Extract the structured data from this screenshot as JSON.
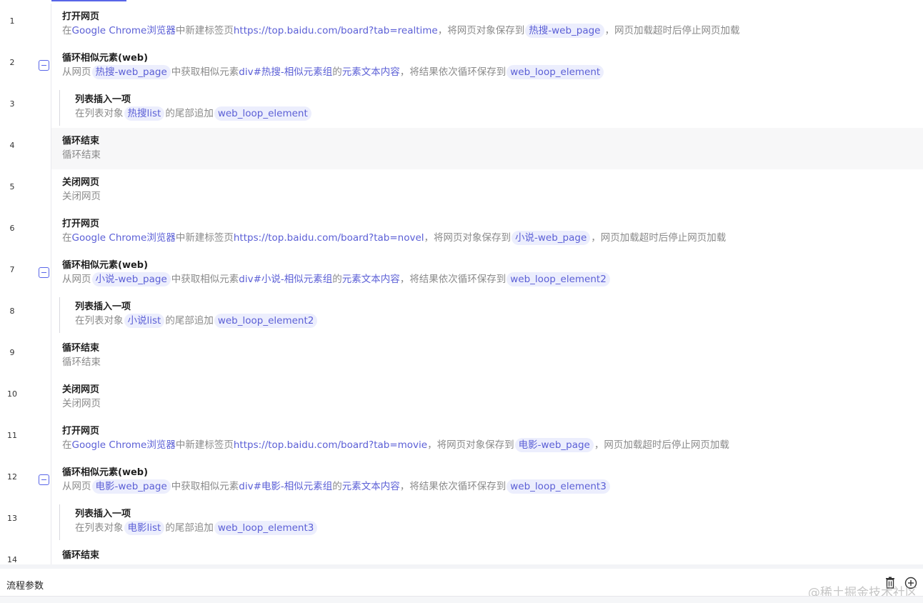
{
  "steps": [
    {
      "no": "1",
      "title": "打开网页",
      "level": 0,
      "collapsible": false,
      "highlight": false,
      "desc": [
        {
          "t": "text",
          "v": "在"
        },
        {
          "t": "link",
          "v": "Google Chrome浏览器"
        },
        {
          "t": "text",
          "v": "中新建标签页"
        },
        {
          "t": "link",
          "v": "https://top.baidu.com/board?tab=realtime"
        },
        {
          "t": "text",
          "v": "，将网页对象保存到"
        },
        {
          "t": "chip",
          "v": "热搜-web_page"
        },
        {
          "t": "text",
          "v": "，网页加载超时后停止网页加载"
        }
      ]
    },
    {
      "no": "2",
      "title": "循环相似元素(web)",
      "level": 0,
      "collapsible": true,
      "highlight": false,
      "desc": [
        {
          "t": "text",
          "v": "从网页"
        },
        {
          "t": "chip",
          "v": "热搜-web_page"
        },
        {
          "t": "text",
          "v": "中获取相似元素"
        },
        {
          "t": "link",
          "v": "div#热搜-相似元素组"
        },
        {
          "t": "text",
          "v": "的"
        },
        {
          "t": "link",
          "v": "元素文本内容"
        },
        {
          "t": "text",
          "v": "，将结果依次循环保存到"
        },
        {
          "t": "chip",
          "v": "web_loop_element"
        }
      ]
    },
    {
      "no": "3",
      "title": "列表插入一项",
      "level": 1,
      "collapsible": false,
      "highlight": false,
      "desc": [
        {
          "t": "text",
          "v": "在列表对象"
        },
        {
          "t": "chip",
          "v": "热搜list"
        },
        {
          "t": "text",
          "v": "的尾部追加"
        },
        {
          "t": "chip",
          "v": "web_loop_element"
        }
      ]
    },
    {
      "no": "4",
      "title": "循环结束",
      "level": 0,
      "collapsible": false,
      "highlight": true,
      "desc": [
        {
          "t": "text",
          "v": "循环结束"
        }
      ]
    },
    {
      "no": "5",
      "title": "关闭网页",
      "level": 0,
      "collapsible": false,
      "highlight": false,
      "desc": [
        {
          "t": "text",
          "v": "关闭网页"
        }
      ]
    },
    {
      "no": "6",
      "title": "打开网页",
      "level": 0,
      "collapsible": false,
      "highlight": false,
      "desc": [
        {
          "t": "text",
          "v": "在"
        },
        {
          "t": "link",
          "v": "Google Chrome浏览器"
        },
        {
          "t": "text",
          "v": "中新建标签页"
        },
        {
          "t": "link",
          "v": "https://top.baidu.com/board?tab=novel"
        },
        {
          "t": "text",
          "v": "，将网页对象保存到"
        },
        {
          "t": "chip",
          "v": "小说-web_page"
        },
        {
          "t": "text",
          "v": "，网页加载超时后停止网页加载"
        }
      ]
    },
    {
      "no": "7",
      "title": "循环相似元素(web)",
      "level": 0,
      "collapsible": true,
      "highlight": false,
      "desc": [
        {
          "t": "text",
          "v": "从网页"
        },
        {
          "t": "chip",
          "v": "小说-web_page"
        },
        {
          "t": "text",
          "v": "中获取相似元素"
        },
        {
          "t": "link",
          "v": "div#小说-相似元素组"
        },
        {
          "t": "text",
          "v": "的"
        },
        {
          "t": "link",
          "v": "元素文本内容"
        },
        {
          "t": "text",
          "v": "，将结果依次循环保存到"
        },
        {
          "t": "chip",
          "v": "web_loop_element2"
        }
      ]
    },
    {
      "no": "8",
      "title": "列表插入一项",
      "level": 1,
      "collapsible": false,
      "highlight": false,
      "desc": [
        {
          "t": "text",
          "v": "在列表对象"
        },
        {
          "t": "chip",
          "v": "小说list"
        },
        {
          "t": "text",
          "v": "的尾部追加"
        },
        {
          "t": "chip",
          "v": "web_loop_element2"
        }
      ]
    },
    {
      "no": "9",
      "title": "循环结束",
      "level": 0,
      "collapsible": false,
      "highlight": false,
      "desc": [
        {
          "t": "text",
          "v": "循环结束"
        }
      ]
    },
    {
      "no": "10",
      "title": "关闭网页",
      "level": 0,
      "collapsible": false,
      "highlight": false,
      "desc": [
        {
          "t": "text",
          "v": "关闭网页"
        }
      ]
    },
    {
      "no": "11",
      "title": "打开网页",
      "level": 0,
      "collapsible": false,
      "highlight": false,
      "desc": [
        {
          "t": "text",
          "v": "在"
        },
        {
          "t": "link",
          "v": "Google Chrome浏览器"
        },
        {
          "t": "text",
          "v": "中新建标签页"
        },
        {
          "t": "link",
          "v": "https://top.baidu.com/board?tab=movie"
        },
        {
          "t": "text",
          "v": "，将网页对象保存到"
        },
        {
          "t": "chip",
          "v": "电影-web_page"
        },
        {
          "t": "text",
          "v": "，网页加载超时后停止网页加载"
        }
      ]
    },
    {
      "no": "12",
      "title": "循环相似元素(web)",
      "level": 0,
      "collapsible": true,
      "highlight": false,
      "desc": [
        {
          "t": "text",
          "v": "从网页"
        },
        {
          "t": "chip",
          "v": "电影-web_page"
        },
        {
          "t": "text",
          "v": "中获取相似元素"
        },
        {
          "t": "link",
          "v": "div#电影-相似元素组"
        },
        {
          "t": "text",
          "v": "的"
        },
        {
          "t": "link",
          "v": "元素文本内容"
        },
        {
          "t": "text",
          "v": "，将结果依次循环保存到"
        },
        {
          "t": "chip",
          "v": "web_loop_element3"
        }
      ]
    },
    {
      "no": "13",
      "title": "列表插入一项",
      "level": 1,
      "collapsible": false,
      "highlight": false,
      "desc": [
        {
          "t": "text",
          "v": "在列表对象"
        },
        {
          "t": "chip",
          "v": "电影list"
        },
        {
          "t": "text",
          "v": "的尾部追加"
        },
        {
          "t": "chip",
          "v": "web_loop_element3"
        }
      ]
    },
    {
      "no": "14",
      "title": "循环结束",
      "level": 0,
      "collapsible": false,
      "highlight": false,
      "desc": []
    }
  ],
  "params_panel": {
    "title": "流程参数",
    "delete_icon": "trash-icon",
    "add_icon": "plus-circle-icon"
  },
  "watermark": "@稀土掘金技术社区",
  "colors": {
    "accent": "#5865e8",
    "chip_bg": "#eceefd",
    "link": "#5b5fd6",
    "desc_text": "#8a8a8a"
  }
}
